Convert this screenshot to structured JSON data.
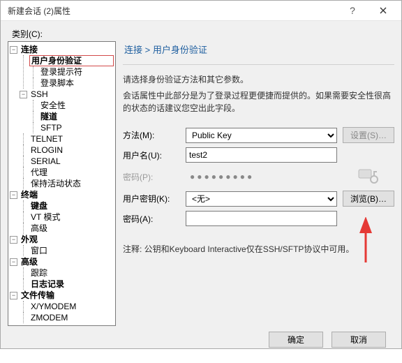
{
  "window": {
    "title": "新建会话 (2)属性"
  },
  "category_label": "类别(C):",
  "tree": {
    "n_connection": "连接",
    "n_auth": "用户身份验证",
    "n_loginprompt": "登录提示符",
    "n_loginscript": "登录脚本",
    "n_ssh": "SSH",
    "n_security": "安全性",
    "n_tunnel": "隧道",
    "n_sftp": "SFTP",
    "n_telnet": "TELNET",
    "n_rlogin": "RLOGIN",
    "n_serial": "SERIAL",
    "n_proxy": "代理",
    "n_keepalive": "保持活动状态",
    "n_terminal": "终端",
    "n_keyboard": "键盘",
    "n_vtmode": "VT 模式",
    "n_advanced": "高级",
    "n_appearance": "外观",
    "n_window": "窗口",
    "n_advanced2": "高级",
    "n_trace": "跟踪",
    "n_logging": "日志记录",
    "n_filetransfer": "文件传输",
    "n_xymodem": "X/YMODEM",
    "n_zmodem": "ZMODEM"
  },
  "right": {
    "crumb": "连接 > 用户身份验证",
    "desc": "请选择身份验证方法和其它参数。",
    "hint": "会话属性中此部分是为了登录过程更便捷而提供的。如果需要安全性很高的状态的话建议您空出此字段。",
    "labels": {
      "method": "方法(M):",
      "username": "用户名(U):",
      "password": "密码(P):",
      "userkey": "用户密钥(K):",
      "passphrase": "密码(A):"
    },
    "values": {
      "method": "Public Key",
      "username": "test2",
      "password": "●●●●●●●●●",
      "userkey": "<无>",
      "passphrase": ""
    },
    "buttons": {
      "setup": "设置(S)…",
      "browse": "浏览(B)…"
    },
    "note": "注释: 公钥和Keyboard Interactive仅在SSH/SFTP协议中可用。"
  },
  "footer": {
    "ok": "确定",
    "cancel": "取消"
  }
}
